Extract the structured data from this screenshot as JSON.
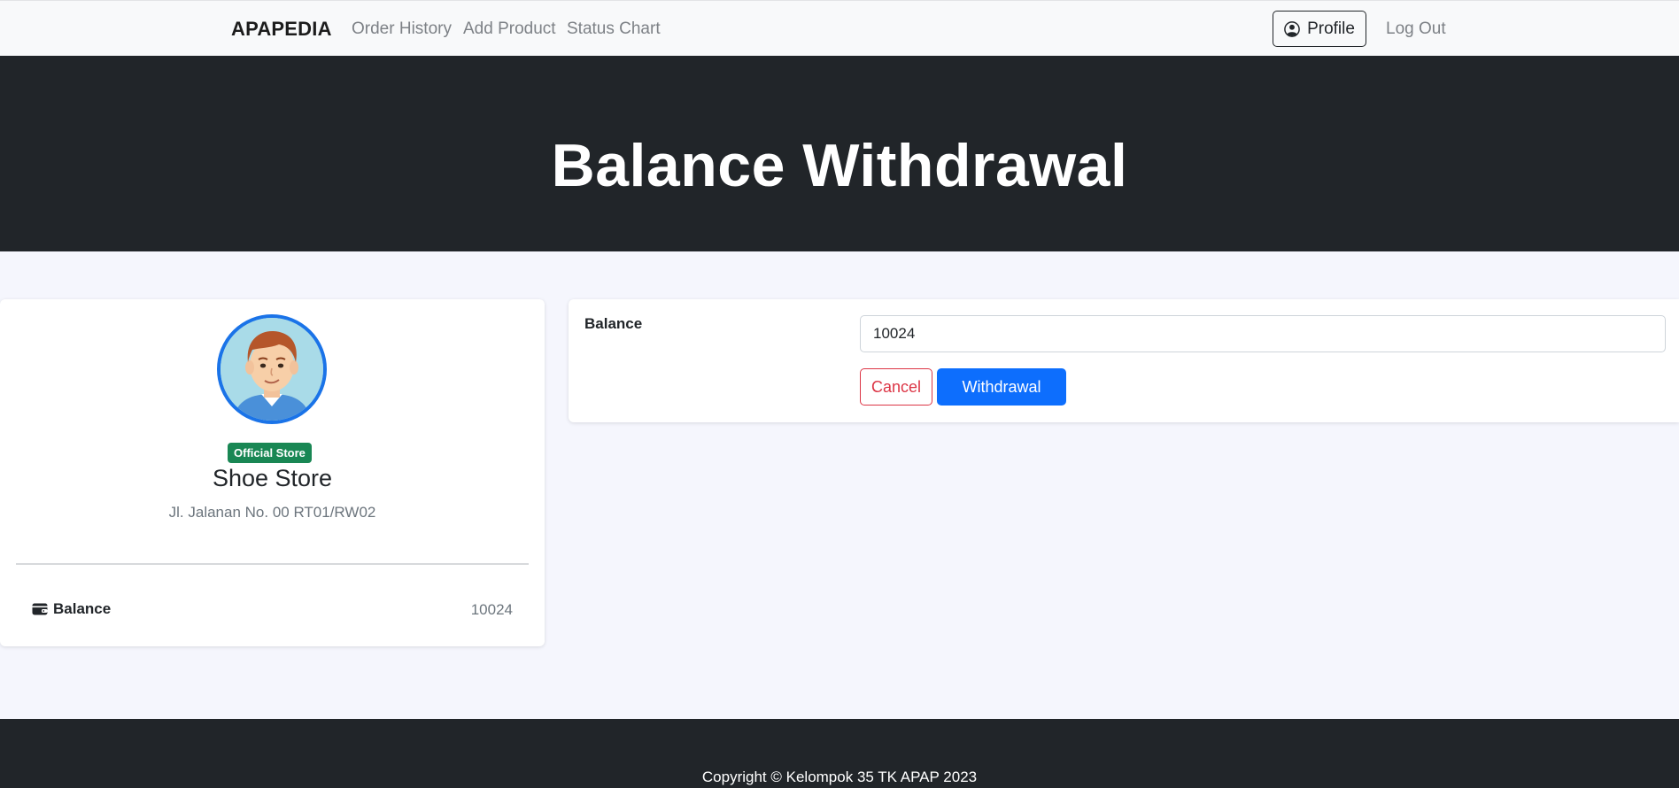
{
  "navbar": {
    "brand": "APAPEDIA",
    "links": [
      "Order History",
      "Add Product",
      "Status Chart"
    ],
    "profile_label": "Profile",
    "logout_label": "Log Out",
    "profile_icon": "person-circle-icon"
  },
  "hero": {
    "title": "Balance Withdrawal"
  },
  "profile_card": {
    "avatar_icon": "user-avatar",
    "badge": "Official Store",
    "store_name": "Shoe Store",
    "address": "Jl. Jalanan No. 00 RT01/RW02",
    "balance_label": "Balance",
    "balance_icon": "wallet-icon",
    "balance_value": "10024"
  },
  "form": {
    "balance_label": "Balance",
    "balance_value": "10024",
    "cancel_label": "Cancel",
    "withdraw_label": "Withdrawal"
  },
  "footer": {
    "copyright": "Copyright © Kelompok 35 TK APAP 2023"
  },
  "colors": {
    "dark": "#212529",
    "primary": "#0d6efd",
    "danger": "#dc3545",
    "success": "#198754",
    "background": "#f5f6fd"
  }
}
